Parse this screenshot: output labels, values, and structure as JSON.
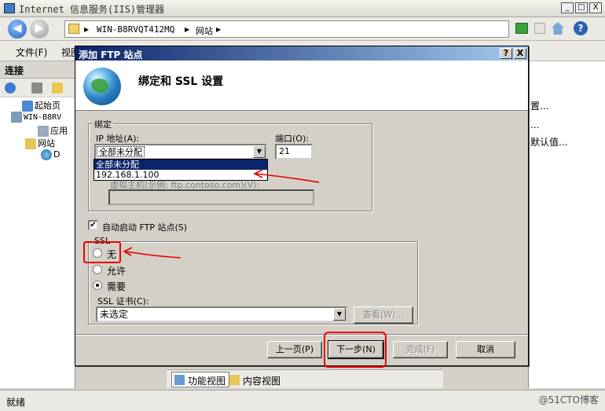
{
  "window": {
    "title": "Internet 信息服务(IIS)管理器",
    "controls": [
      "_",
      "□",
      "X"
    ]
  },
  "address": {
    "segments": [
      "WIN-B8RVQT412MQ",
      "网站"
    ],
    "separator": "▶",
    "help": "?"
  },
  "menubar": {
    "items": [
      "文件(F)",
      "视图"
    ]
  },
  "left_pane": {
    "header": "连接",
    "tree": [
      "起始页",
      "WIN-B8RV",
      "应用",
      "网站",
      "D"
    ]
  },
  "right_pane": {
    "items": [
      "置...",
      "...",
      "默认值..."
    ]
  },
  "bottom_tabs": {
    "features_view": "功能视图",
    "content_view": "内容视图"
  },
  "status": {
    "text": "就绪",
    "watermark": "@51CTO博客"
  },
  "dialog": {
    "title": "添加 FTP 站点",
    "help": "?",
    "close": "X",
    "header_title": "绑定和 SSL 设置",
    "binding": {
      "legend": "绑定",
      "ip_label": "IP 地址(A):",
      "ip_value": "全部未分配",
      "ip_options": [
        "全部未分配",
        "192.168.1.100"
      ],
      "port_label": "端口(O):",
      "port_value": "21",
      "vhost_hint": "虚拟主机(示例: ftp.contoso.com)(V):"
    },
    "autostart": {
      "label": "自动启动 FTP 站点(S)",
      "checked": true,
      "mark": "✔"
    },
    "ssl": {
      "legend": "SSL",
      "options": [
        "无",
        "允许",
        "需要"
      ],
      "selected": "需要",
      "cert_label": "SSL 证书(C):",
      "cert_value": "未选定",
      "view_button": "查看(W)..."
    },
    "buttons": {
      "prev": "上一页(P)",
      "next": "下一步(N)",
      "finish": "完成(F)",
      "cancel": "取消"
    }
  },
  "colors": {
    "annotation": "#e00000",
    "dialog_title": "#0a246a"
  }
}
